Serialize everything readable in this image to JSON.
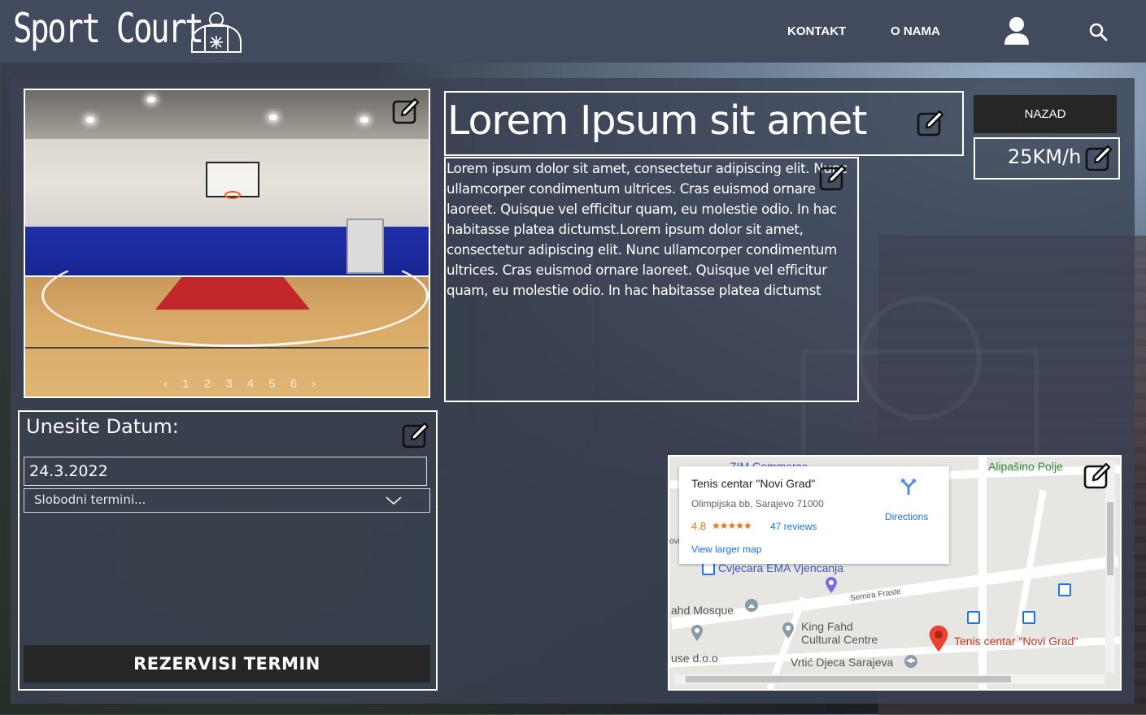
{
  "header": {
    "logo_text": "Sport Court",
    "nav": {
      "kontakt": "KONTAKT",
      "onama": "O NAMA"
    },
    "icons": {
      "user": "user-icon",
      "search": "search-icon"
    },
    "background_color": "#424a5e"
  },
  "gallery": {
    "pages": [
      "1",
      "2",
      "3",
      "4",
      "5",
      "6"
    ],
    "prev": "‹",
    "next": "›"
  },
  "court": {
    "title": "Lorem Ipsum sit amet",
    "description": "Lorem ipsum dolor sit amet, consectetur adipiscing elit. Nunc ullamcorper condimentum ultrices. Cras euismod ornare laoreet. Quisque vel efficitur quam, eu molestie odio. In hac habitasse platea dictumst.Lorem ipsum dolor sit amet, consectetur adipiscing elit. Nunc ullamcorper condimentum ultrices. Cras euismod ornare laoreet. Quisque vel efficitur quam, eu molestie odio. In hac habitasse platea dictumst",
    "speed": "25KM/h"
  },
  "actions": {
    "back_label": "NAZAD"
  },
  "reservation": {
    "label": "Unesite Datum:",
    "date_value": "24.3.2022",
    "slots_placeholder": "Slobodni termini...",
    "submit_label": "REZERVISI TERMIN"
  },
  "map": {
    "card": {
      "name": "Tenis centar \"Novi Grad\"",
      "address": "Olimpijska bb, Sarajevo 71000",
      "rating": "4.8",
      "stars": "★★★★★",
      "reviews": "47 reviews",
      "larger": "View larger map",
      "directions": "Directions"
    },
    "labels": {
      "zim": "ZIM Commerce",
      "alipasino": "Alipašino Polje",
      "cvjecara": "Cvjecara EMA Vjencanja",
      "mosque": "ahd Mosque",
      "semira": "Semira Fraste",
      "kingfahd1": "King Fahd",
      "kingfahd2": "Cultural Centre",
      "tenis": "Tenis centar \"Novi Grad\"",
      "doo": "use d.o.o",
      "vrtic": "Vrtić Djeca Sarajeva",
      "ovi": "ovi"
    },
    "colors": {
      "pin": "#ea4335",
      "link": "#1a73e8",
      "rating": "#e7711b"
    }
  },
  "icons": {
    "edit": "edit-icon"
  }
}
